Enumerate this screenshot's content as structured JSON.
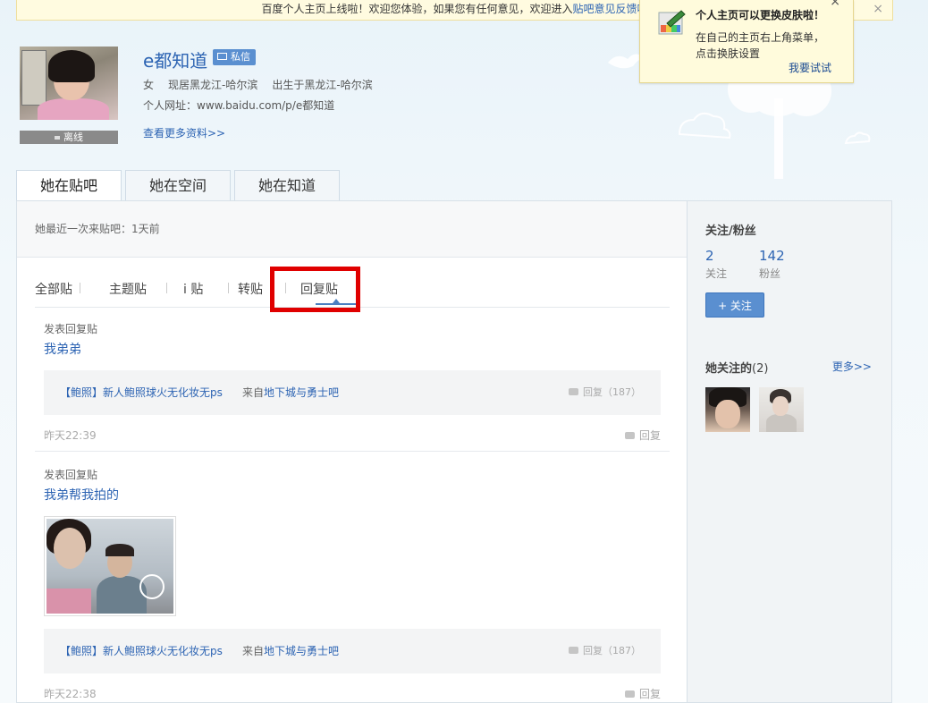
{
  "notice": {
    "text": "百度个人主页上线啦！欢迎您体验，如果您有任何意见，欢迎进入",
    "link": "贴吧意见反馈吧",
    "close": "×"
  },
  "skin_tip": {
    "title": "个人主页可以更换皮肤啦！",
    "line1": "在自己的主页右上角菜单，",
    "line2": "点击换肤设置",
    "action": "我要试试",
    "close": "×"
  },
  "profile": {
    "name": "e都知道",
    "pm_label": "私信",
    "gender": "女",
    "residence": "现居黑龙江-哈尔滨",
    "birthplace": "出生于黑龙江-哈尔滨",
    "url": "个人网址：www.baidu.com/p/e都知道",
    "more_info": "查看更多资料>>",
    "status": "离线"
  },
  "tabs": [
    {
      "label": "她在贴吧",
      "active": true
    },
    {
      "label": "她在空间",
      "active": false
    },
    {
      "label": "她在知道",
      "active": false
    }
  ],
  "last_visit": "她最近一次来贴吧：1天前",
  "subtabs": [
    {
      "label": "全部贴"
    },
    {
      "label": "主题贴"
    },
    {
      "label": "i 贴"
    },
    {
      "label": "转贴"
    },
    {
      "label": "回复贴"
    }
  ],
  "posts": [
    {
      "kind": "发表回复贴",
      "title": "我弟弟",
      "thread": "【鲍照】新人鲍照球火无化妆无ps",
      "from_prefix": "来自",
      "forum": "地下城与勇士吧",
      "reply_count": "回复（187）",
      "time": "昨天22:39",
      "reply": "回复"
    },
    {
      "kind": "发表回复贴",
      "title": "我弟帮我拍的",
      "thread": "【鲍照】新人鲍照球火无化妆无ps",
      "from_prefix": "来自",
      "forum": "地下城与勇士吧",
      "reply_count": "回复（187）",
      "time": "昨天22:38",
      "reply": "回复"
    }
  ],
  "sidebar": {
    "heading": "关注/粉丝",
    "following_count": "2",
    "following_label": "关注",
    "fans_count": "142",
    "fans_label": "粉丝",
    "follow_button": "+ 关注",
    "her_following": "她关注的",
    "her_following_count": "(2)",
    "more": "更多>>"
  },
  "colors": {
    "accent": "#2d64b3",
    "button": "#5a8fd0",
    "highlight": "#e00000"
  }
}
